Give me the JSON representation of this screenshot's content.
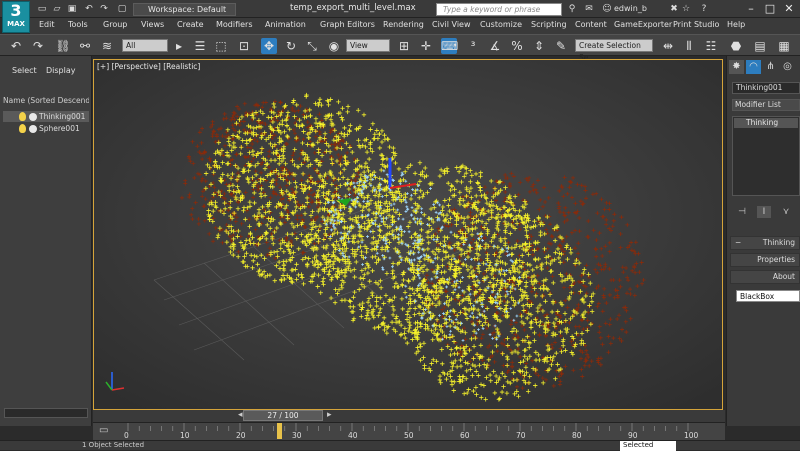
{
  "app": {
    "logo_text": "MAX",
    "document_title": "temp_export_multi_level.max"
  },
  "workspace": {
    "label": "Workspace: Default"
  },
  "search": {
    "placeholder": "Type a keyword or phrase"
  },
  "user": {
    "name": "edwin_b"
  },
  "menu": [
    "Edit",
    "Tools",
    "Group",
    "Views",
    "Create",
    "Modifiers",
    "Animation",
    "Graph Editors",
    "Rendering",
    "Civil View",
    "Customize",
    "Scripting",
    "Content",
    "GameExporter",
    "Print Studio",
    "Help"
  ],
  "toolbar": {
    "filter_select": "All",
    "coord_select": "View",
    "selection_set": "Create Selection Se"
  },
  "left_panel": {
    "tabs": [
      "Select",
      "Display"
    ],
    "header": "Name (Sorted Descending)",
    "items": [
      {
        "name": "Thinking001",
        "selected": true
      },
      {
        "name": "Sphere001",
        "selected": false
      }
    ]
  },
  "viewport": {
    "label": "[+] [Perspective] [Realistic]"
  },
  "command_panel": {
    "object_name": "Thinking001",
    "modifier_list": "Modifier List",
    "stack_item": "Thinking",
    "rollouts": {
      "thinking": "Thinking",
      "properties": "Properties",
      "about": "About"
    },
    "blackbox": "BlackBox"
  },
  "time": {
    "frame_display": "27 / 100",
    "ticks": [
      0,
      10,
      20,
      30,
      40,
      50,
      60,
      70,
      80,
      90,
      100
    ],
    "current_frame": 27,
    "total_frames": 100
  },
  "status": {
    "text": "1 Object Selected",
    "selected_label": "Selected"
  },
  "colors": {
    "accent": "#2d7dbf",
    "viewport_border": "#d5a43a",
    "particle_yellow": "#f6f22a",
    "particle_red": "#8a2a0a"
  }
}
